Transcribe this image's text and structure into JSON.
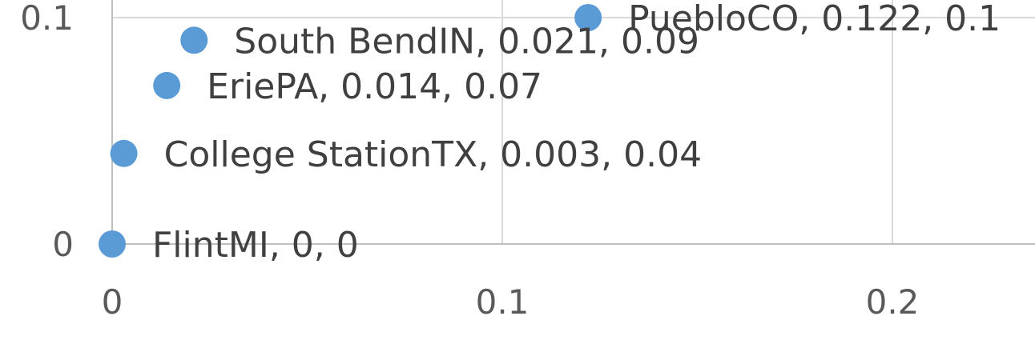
{
  "chart_data": {
    "type": "scatter",
    "title": "",
    "xlabel": "",
    "ylabel": "",
    "xlim": [
      0,
      0.235
    ],
    "ylim": [
      -0.01,
      0.11
    ],
    "x_ticks": [
      "0",
      "0.1",
      "0.2"
    ],
    "x_tick_values": [
      0,
      0.1,
      0.2
    ],
    "y_ticks": [
      "0",
      "0.1"
    ],
    "y_tick_values": [
      0,
      0.1
    ],
    "grid": true,
    "marker_color": "#5b9bd5",
    "points": [
      {
        "name": "FlintMI",
        "x": 0,
        "y": 0,
        "label": "FlintMI, 0, 0"
      },
      {
        "name": "College StationTX",
        "x": 0.003,
        "y": 0.04,
        "label": "College StationTX, 0.003, 0.04"
      },
      {
        "name": "EriePA",
        "x": 0.014,
        "y": 0.07,
        "label": "EriePA, 0.014, 0.07"
      },
      {
        "name": "South BendIN",
        "x": 0.021,
        "y": 0.09,
        "label": "South BendIN, 0.021, 0.09"
      },
      {
        "name": "PuebloCO",
        "x": 0.122,
        "y": 0.1,
        "label": "PuebloCO, 0.122, 0.1"
      }
    ]
  }
}
